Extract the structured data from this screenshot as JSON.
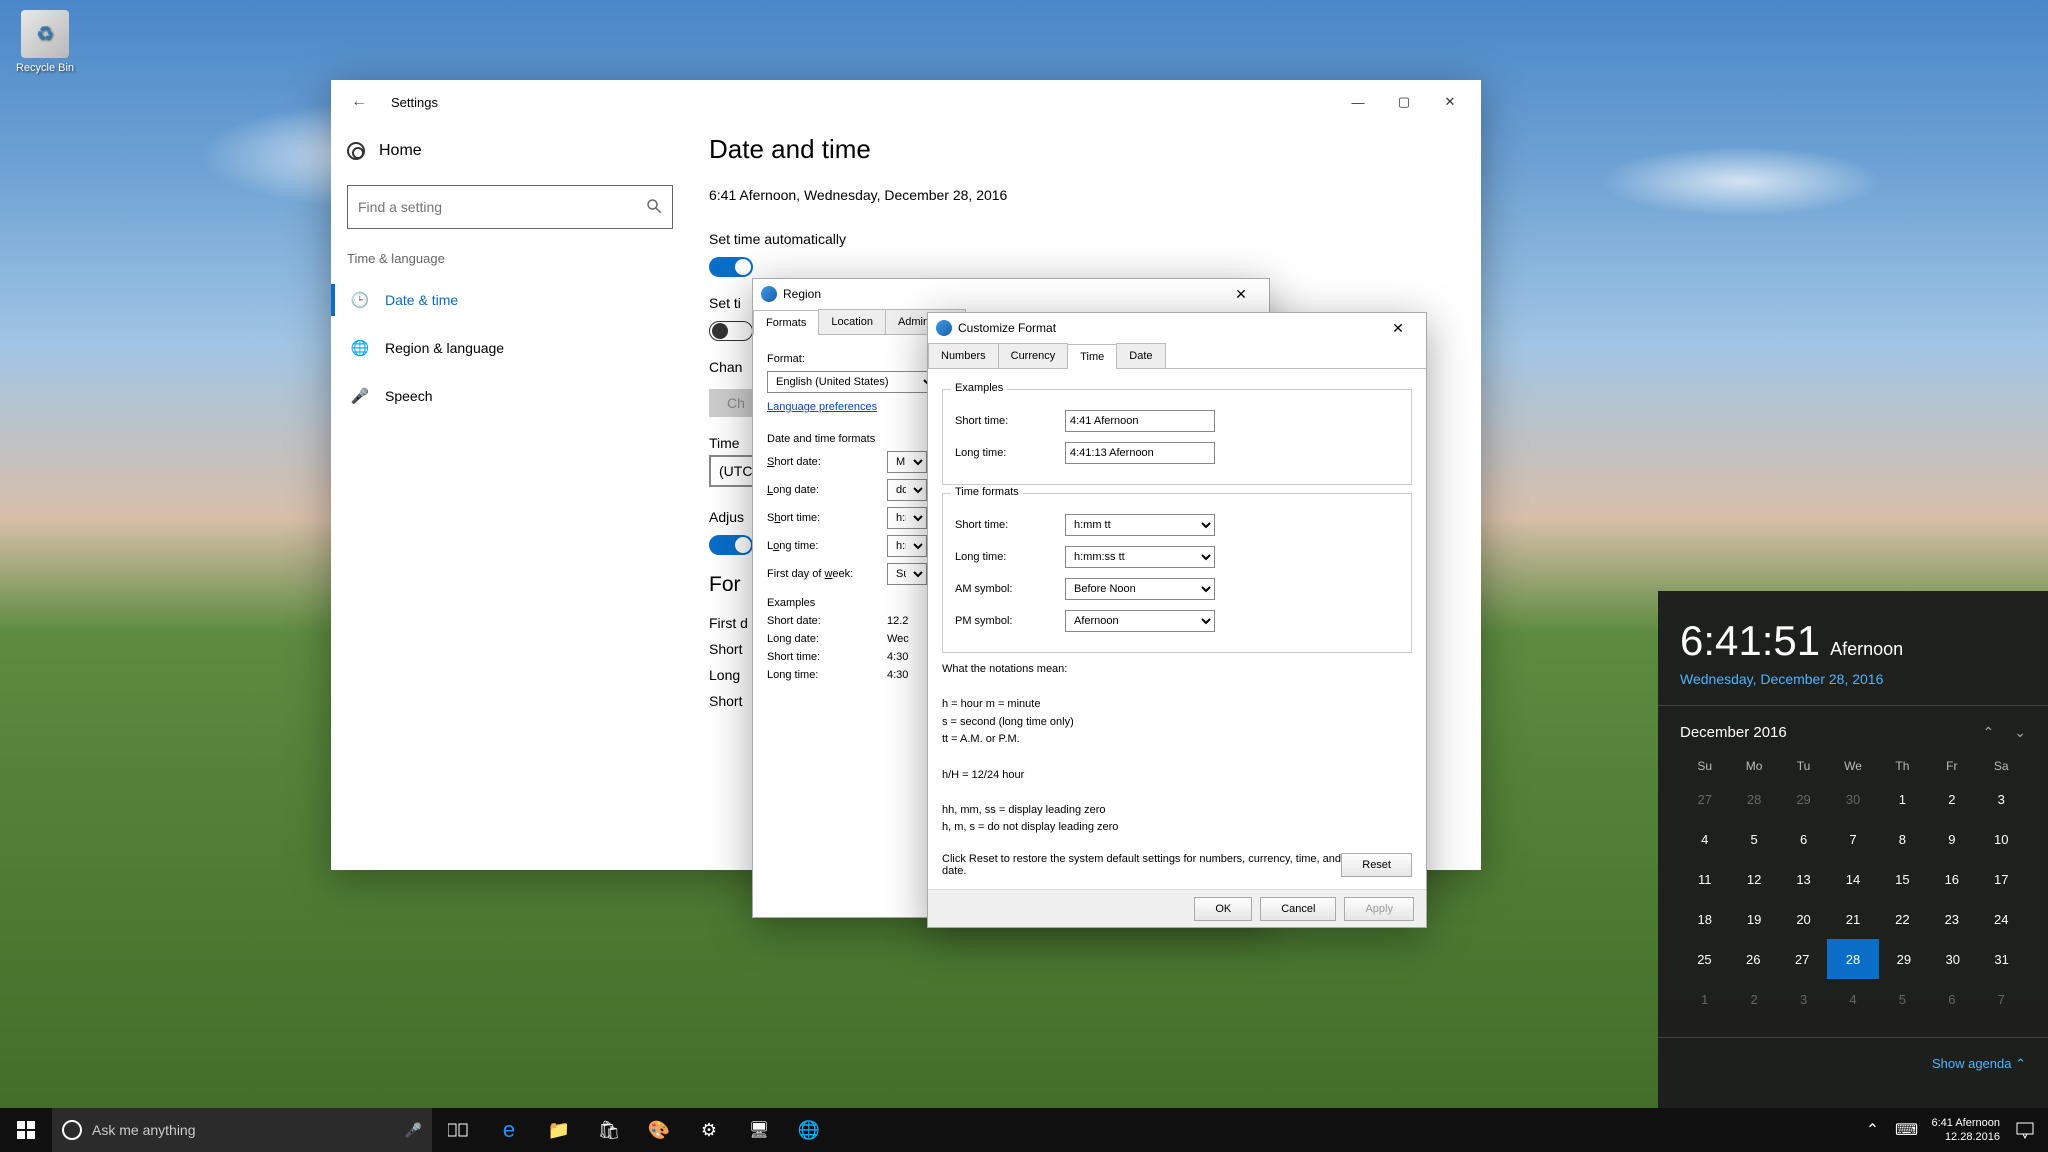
{
  "desktop": {
    "recycle_bin": "Recycle Bin"
  },
  "settings": {
    "title": "Settings",
    "home": "Home",
    "search_placeholder": "Find a setting",
    "section": "Time & language",
    "nav": {
      "date_time": "Date & time",
      "region": "Region & language",
      "speech": "Speech"
    },
    "main": {
      "heading": "Date and time",
      "current": "6:41 Afernoon, Wednesday, December 28, 2016",
      "auto_time": "Set time automatically",
      "auto_tz_partial": "Set ti",
      "change_label": "Chan",
      "change_button": "Ch",
      "tz_label": "Time",
      "tz_value": "(UTC",
      "adjust_label": "Adjus",
      "formats_heading": "For",
      "first_d": "First d",
      "short_t": "Short",
      "long_t": "Long",
      "last_short": "Short"
    }
  },
  "region": {
    "title": "Region",
    "tabs": {
      "formats": "Formats",
      "location": "Location",
      "admin": "Administrat"
    },
    "format_label": "Format:",
    "format_value": "English (United States)",
    "lang_pref": "Language preferences",
    "dt_heading": "Date and time formats",
    "short_date": "Short date:",
    "short_date_v": "M.",
    "long_date": "Long date:",
    "long_date_v": "dd",
    "short_time": "Short time:",
    "short_time_v": "h:m",
    "long_time": "Long time:",
    "long_time_v": "h:m",
    "first_day": "First day of week:",
    "first_day_v": "Sur",
    "examples": "Examples",
    "ex_short_date": "12.2",
    "ex_long_date": "Wec",
    "ex_short_time": "4:30",
    "ex_long_time": "4:30"
  },
  "custom": {
    "title": "Customize Format",
    "tabs": {
      "numbers": "Numbers",
      "currency": "Currency",
      "time": "Time",
      "date": "Date"
    },
    "examples": "Examples",
    "ex_short_label": "Short time:",
    "ex_short": "4:41 Afernoon",
    "ex_long_label": "Long time:",
    "ex_long": "4:41:13 Afernoon",
    "tf_heading": "Time formats",
    "short_t_label": "Short time:",
    "short_t_v": "h:mm tt",
    "long_t_label": "Long time:",
    "long_t_v": "h:mm:ss tt",
    "am_label": "AM symbol:",
    "am_v": "Before Noon",
    "pm_label": "PM symbol:",
    "pm_v": "Afernoon",
    "notations_h": "What the notations mean:",
    "note1": "h = hour   m = minute",
    "note2": "s = second (long time only)",
    "note3": "tt = A.M. or P.M.",
    "note4": "h/H = 12/24 hour",
    "note5": "hh, mm, ss  =  display leading zero",
    "note6": "h, m, s  =  do not display leading zero",
    "reset_text": "Click Reset to restore the system default settings for numbers, currency, time, and date.",
    "reset_btn": "Reset",
    "ok": "OK",
    "cancel": "Cancel",
    "apply": "Apply"
  },
  "flyout": {
    "time": "6:41:51",
    "suffix": "Afernoon",
    "date_full": "Wednesday, December 28, 2016",
    "month": "December 2016",
    "dow": [
      "Su",
      "Mo",
      "Tu",
      "We",
      "Th",
      "Fr",
      "Sa"
    ],
    "weeks": [
      [
        {
          "d": 27,
          "dim": true
        },
        {
          "d": 28,
          "dim": true
        },
        {
          "d": 29,
          "dim": true
        },
        {
          "d": 30,
          "dim": true
        },
        {
          "d": 1
        },
        {
          "d": 2
        },
        {
          "d": 3
        }
      ],
      [
        {
          "d": 4
        },
        {
          "d": 5
        },
        {
          "d": 6
        },
        {
          "d": 7
        },
        {
          "d": 8
        },
        {
          "d": 9
        },
        {
          "d": 10
        }
      ],
      [
        {
          "d": 11
        },
        {
          "d": 12
        },
        {
          "d": 13
        },
        {
          "d": 14
        },
        {
          "d": 15
        },
        {
          "d": 16
        },
        {
          "d": 17
        }
      ],
      [
        {
          "d": 18
        },
        {
          "d": 19
        },
        {
          "d": 20
        },
        {
          "d": 21
        },
        {
          "d": 22
        },
        {
          "d": 23
        },
        {
          "d": 24
        }
      ],
      [
        {
          "d": 25
        },
        {
          "d": 26
        },
        {
          "d": 27
        },
        {
          "d": 28,
          "today": true
        },
        {
          "d": 29
        },
        {
          "d": 30
        },
        {
          "d": 31
        }
      ],
      [
        {
          "d": 1,
          "dim": true
        },
        {
          "d": 2,
          "dim": true
        },
        {
          "d": 3,
          "dim": true
        },
        {
          "d": 4,
          "dim": true
        },
        {
          "d": 5,
          "dim": true
        },
        {
          "d": 6,
          "dim": true
        },
        {
          "d": 7,
          "dim": true
        }
      ]
    ],
    "show_agenda": "Show agenda"
  },
  "taskbar": {
    "cortana": "Ask me anything",
    "clock_time": "6:41 Afernoon",
    "clock_date": "12.28.2016"
  }
}
